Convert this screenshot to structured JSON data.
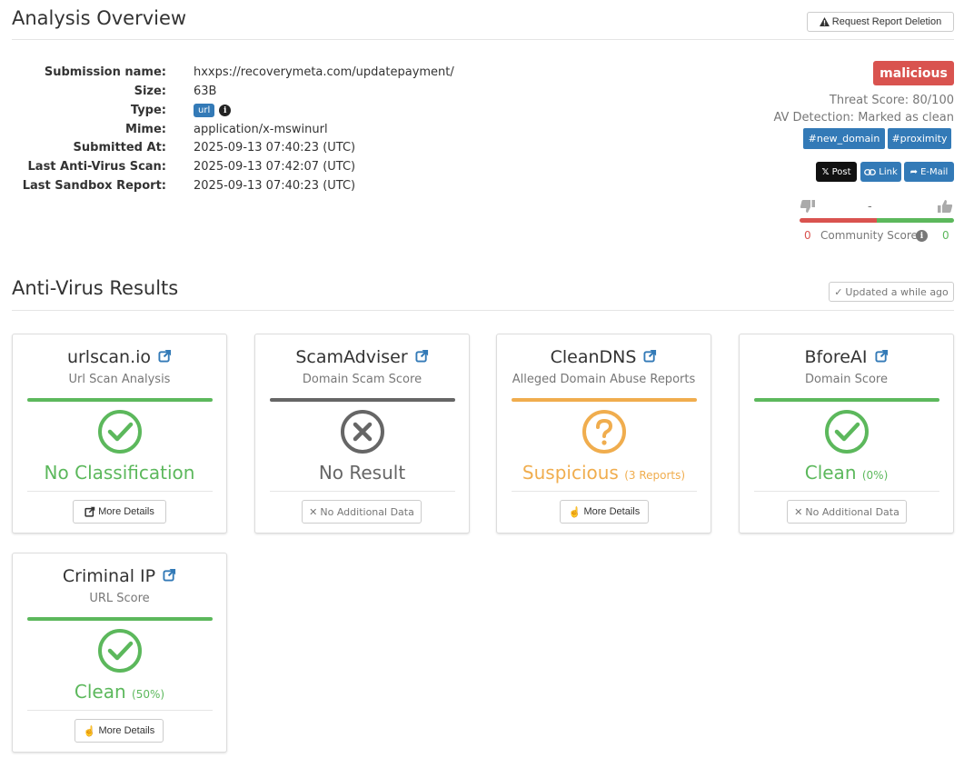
{
  "overview": {
    "title": "Analysis Overview",
    "delete_button": "Request Report Deletion"
  },
  "details": [
    {
      "label": "Submission name:",
      "value": "hxxps://recoverymeta.com/updatepayment/"
    },
    {
      "label": "Size:",
      "value": "63B"
    },
    {
      "label": "Type:",
      "value": "url"
    },
    {
      "label": "Mime:",
      "value": "application/x-mswinurl"
    },
    {
      "label": "Submitted At:",
      "value": "2025-09-13 07:40:23 (UTC)"
    },
    {
      "label": "Last Anti-Virus Scan:",
      "value": "2025-09-13 07:42:07 (UTC)"
    },
    {
      "label": "Last Sandbox Report:",
      "value": "2025-09-13 07:40:23 (UTC)"
    }
  ],
  "summary": {
    "verdict": "malicious",
    "threat_score": "Threat Score: 80/100",
    "av_detection": "AV Detection: Marked as clean",
    "tags": [
      "#new_domain",
      "#proximity"
    ],
    "share": {
      "post": "Post",
      "link": "Link",
      "email": "E-Mail"
    },
    "vote_separator": "-",
    "community": {
      "down": "0",
      "label": "Community Score",
      "up": "0"
    }
  },
  "av": {
    "title": "Anti-Virus Results",
    "updated": "Updated a while ago",
    "cards": [
      {
        "title": "urlscan.io",
        "subtitle": "Url Scan Analysis",
        "result": "No Classification",
        "detail": "",
        "button": "More Details"
      },
      {
        "title": "ScamAdviser",
        "subtitle": "Domain Scam Score",
        "result": "No Result",
        "detail": "",
        "button": "No Additional Data"
      },
      {
        "title": "CleanDNS",
        "subtitle": "Alleged Domain Abuse Reports",
        "result": "Suspicious",
        "detail": "(3 Reports)",
        "button": "More Details"
      },
      {
        "title": "BforeAI",
        "subtitle": "Domain Score",
        "result": "Clean",
        "detail": "(0%)",
        "button": "No Additional Data"
      },
      {
        "title": "Criminal IP",
        "subtitle": "URL Score",
        "result": "Clean",
        "detail": "(50%)",
        "button": "More Details"
      }
    ]
  },
  "colors": {
    "malicious": "#d9534f",
    "clean": "#5cb85c",
    "suspicious": "#f0ad4e",
    "neutral": "#666666",
    "link": "#337ab7"
  },
  "icons": {
    "warning": "warning-triangle-icon",
    "info": "info-circle-icon",
    "external": "external-link-icon",
    "check": "check-circle-icon",
    "times": "times-circle-icon",
    "question": "question-circle-icon"
  }
}
